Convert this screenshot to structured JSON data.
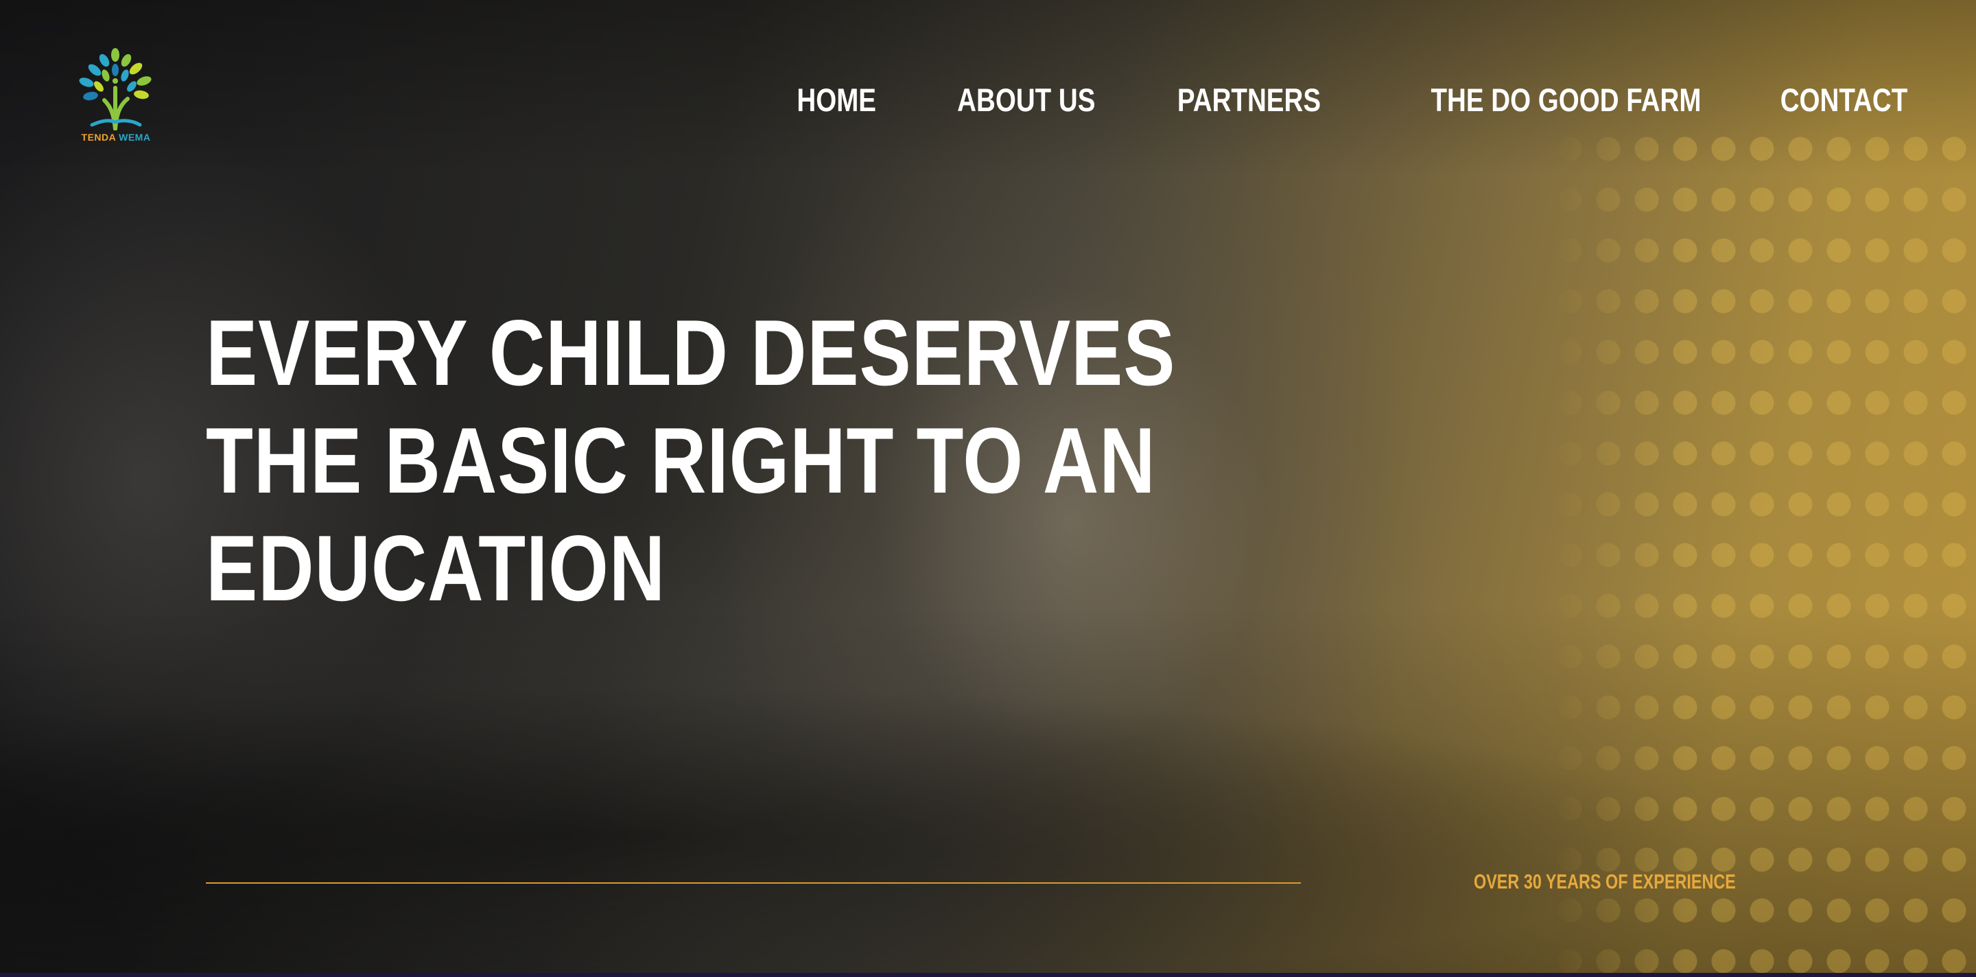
{
  "brand": {
    "logo_word_1": "TENDA",
    "logo_word_2": "WEMA",
    "logo_icon": "tree-icon"
  },
  "nav": {
    "items": [
      {
        "label": "HOME"
      },
      {
        "label": "ABOUT US"
      },
      {
        "label": "PARTNERS"
      },
      {
        "label": "THE DO GOOD FARM"
      },
      {
        "label": "CONTACT"
      }
    ]
  },
  "hero": {
    "headline_lines": [
      "EVERY CHILD DESERVES",
      "THE BASIC RIGHT TO AN",
      "EDUCATION"
    ],
    "experience": "OVER 30 YEARS OF EXPERIENCE"
  },
  "colors": {
    "accent": "#e7a93c",
    "divider": "#d99a32",
    "nav_text": "#ffffff",
    "overlay_gold": "#b28f3c"
  }
}
